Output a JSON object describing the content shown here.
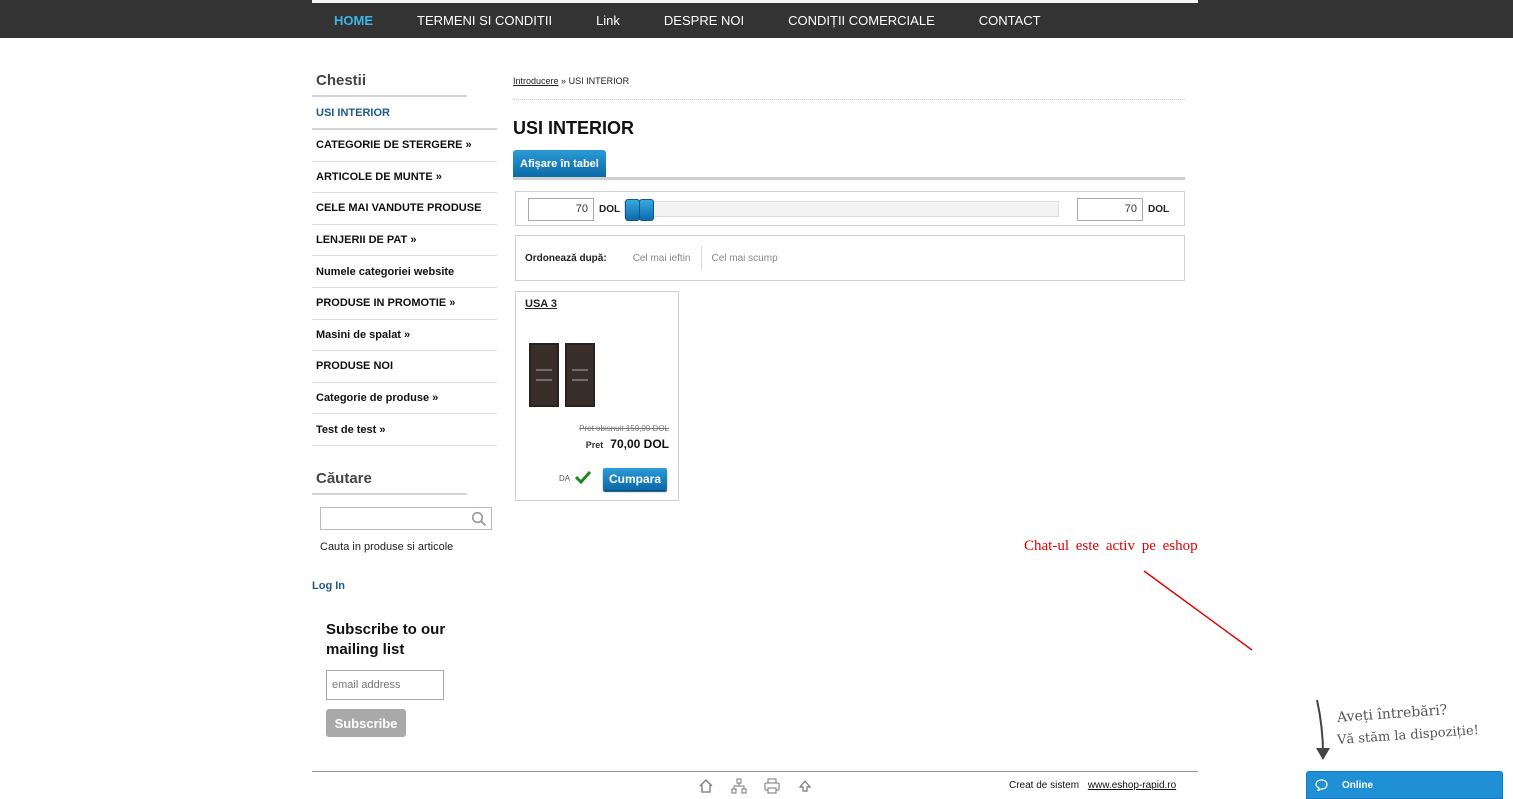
{
  "nav": {
    "items": [
      {
        "label": "HOME",
        "active": true
      },
      {
        "label": "TERMENI SI CONDITII"
      },
      {
        "label": "Link"
      },
      {
        "label": "DESPRE NOI"
      },
      {
        "label": "CONDIȚII COMERCIALE"
      },
      {
        "label": "CONTACT"
      }
    ]
  },
  "sidebar": {
    "categories_title": "Chestii",
    "categories": [
      "USI INTERIOR",
      "CATEGORIE DE STERGERE »",
      "ARTICOLE DE MUNTE »",
      "CELE MAI VANDUTE PRODUSE",
      "LENJERII DE PAT »",
      "Numele categoriei website",
      "PRODUSE IN PROMOTIE »",
      "Masini de spalat »",
      "PRODUSE NOI",
      "Categorie de produse »",
      "Test de test »"
    ],
    "search_title": "Căutare",
    "search_value": "",
    "search_hint": "Cauta in produse si articole",
    "login": "Log In"
  },
  "subscribe": {
    "title": "Subscribe to our mailing list",
    "placeholder": "email address",
    "button": "Subscribe"
  },
  "main": {
    "breadcrumb_link": "Introducere",
    "breadcrumb_sep": "»",
    "breadcrumb_current": "USI INTERIOR",
    "title": "USI INTERIOR",
    "tab_label": "Afișare în tabel",
    "price_min": "70",
    "price_max": "70",
    "currency": "DOL",
    "order_label": "Ordonează după:",
    "order_cheap": "Cel mai ieftin",
    "order_expensive": "Cel mai scump"
  },
  "product": {
    "name": "USA 3",
    "old_price": "Pret obisnuit 150,00 DOL",
    "price_label": "Pret",
    "price": "70,00 DOL",
    "stock": "DA",
    "buy": "Cumpara"
  },
  "chat": {
    "note": "Chat-ul este activ pe eshop",
    "question": "Aveți întrebări?",
    "offer": "Vă stăm la dispoziție!",
    "status": "Online"
  },
  "footer": {
    "credit": "Creat de sistem",
    "link": "www.eshop-rapid.ro",
    "icons": [
      "home-icon",
      "sitemap-icon",
      "print-icon",
      "top-icon"
    ]
  },
  "colors": {
    "topbar": "#333333",
    "nav_active": "#3bb7e6",
    "accent_blue": "#0b6aab",
    "chat_note": "#e00000"
  }
}
